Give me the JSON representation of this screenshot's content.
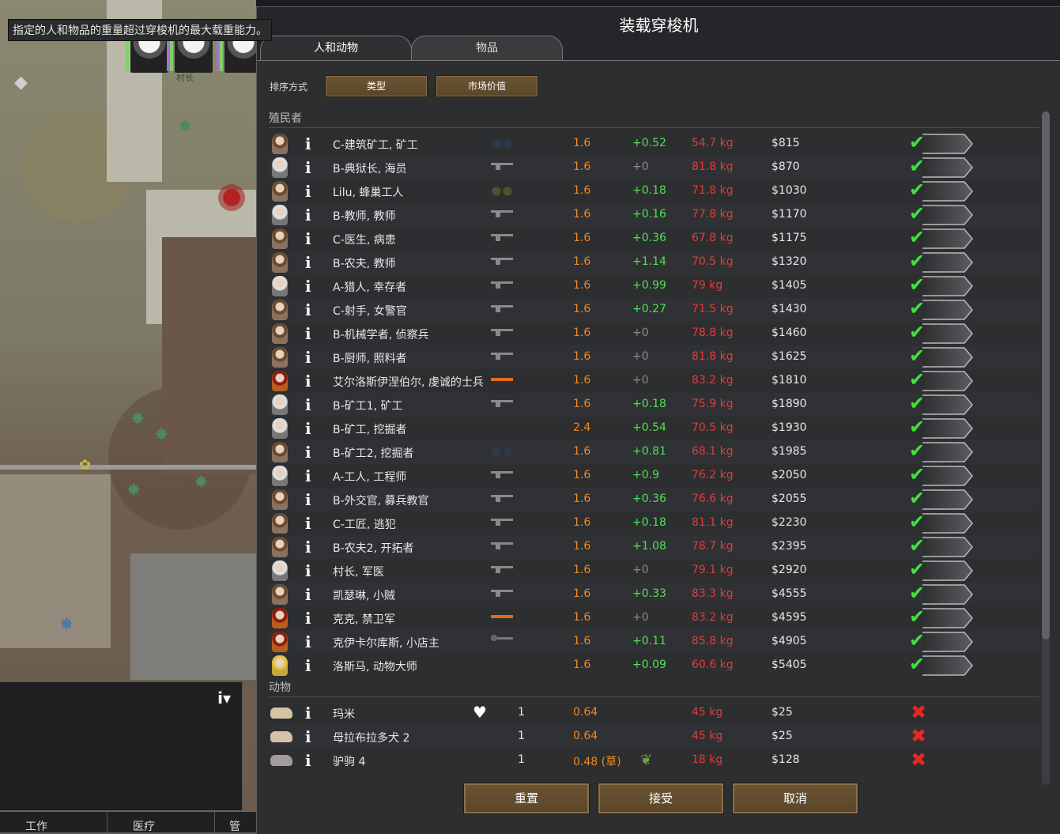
{
  "tooltip": "指定的人和物品的重量超过穿梭机的最大载重能力。",
  "dialog": {
    "title": "装载穿梭机",
    "tabs": [
      {
        "label": "人和动物",
        "active": true
      },
      {
        "label": "物品",
        "active": false
      }
    ],
    "sort": {
      "label": "排序方式",
      "options": [
        "类型",
        "市场价值"
      ]
    },
    "sections": {
      "colonists": "殖民者",
      "animals": "动物"
    },
    "colonists": [
      {
        "name": "C-建筑矿工, 矿工",
        "gear": "binoculars-blue-icon",
        "mass": "1.6",
        "speed": "+0.52",
        "weight": "54.7 kg",
        "value": "$815"
      },
      {
        "name": "B-典狱长, 海员",
        "gear": "rifle-icon",
        "mass": "1.6",
        "speed": "+0",
        "weight": "81.8 kg",
        "value": "$870"
      },
      {
        "name": "Lilu, 蜂巢工人",
        "gear": "binoculars-green-icon",
        "mass": "1.6",
        "speed": "+0.18",
        "weight": "71.8 kg",
        "value": "$1030"
      },
      {
        "name": "B-教师, 教师",
        "gear": "rifle-icon",
        "mass": "1.6",
        "speed": "+0.16",
        "weight": "77.8 kg",
        "value": "$1170"
      },
      {
        "name": "C-医生, 病患",
        "gear": "rifle-icon",
        "mass": "1.6",
        "speed": "+0.36",
        "weight": "67.8 kg",
        "value": "$1175"
      },
      {
        "name": "B-农夫, 教师",
        "gear": "rifle-icon",
        "mass": "1.6",
        "speed": "+1.14",
        "weight": "70.5 kg",
        "value": "$1320"
      },
      {
        "name": "A-猎人, 幸存者",
        "gear": "rifle-icon",
        "mass": "1.6",
        "speed": "+0.99",
        "weight": "79 kg",
        "value": "$1405"
      },
      {
        "name": "C-射手, 女警官",
        "gear": "rifle-icon",
        "mass": "1.6",
        "speed": "+0.27",
        "weight": "71.5 kg",
        "value": "$1430"
      },
      {
        "name": "B-机械学者, 侦察兵",
        "gear": "rifle-icon",
        "mass": "1.6",
        "speed": "+0",
        "weight": "78.8 kg",
        "value": "$1460"
      },
      {
        "name": "B-厨师, 照料者",
        "gear": "rifle-icon",
        "mass": "1.6",
        "speed": "+0",
        "weight": "81.8 kg",
        "value": "$1625"
      },
      {
        "name": "艾尔洛斯伊涅伯尔, 虔诚的士兵",
        "gear": "plasma-blade-icon",
        "mass": "1.6",
        "speed": "+0",
        "weight": "83.2 kg",
        "value": "$1810"
      },
      {
        "name": "B-矿工1, 矿工",
        "gear": "rifle-icon",
        "mass": "1.6",
        "speed": "+0.18",
        "weight": "75.9 kg",
        "value": "$1890"
      },
      {
        "name": "B-矿工, 挖掘者",
        "gear": "none",
        "mass": "2.4",
        "speed": "+0.54",
        "weight": "70.5 kg",
        "value": "$1930"
      },
      {
        "name": "B-矿工2, 挖掘者",
        "gear": "binoculars-blue-icon",
        "mass": "1.6",
        "speed": "+0.81",
        "weight": "68.1 kg",
        "value": "$1985"
      },
      {
        "name": "A-工人, 工程师",
        "gear": "rifle-icon",
        "mass": "1.6",
        "speed": "+0.9",
        "weight": "76.2 kg",
        "value": "$2050"
      },
      {
        "name": "B-外交官, 募兵教官",
        "gear": "rifle-icon",
        "mass": "1.6",
        "speed": "+0.36",
        "weight": "76.6 kg",
        "value": "$2055"
      },
      {
        "name": "C-工匠, 逃犯",
        "gear": "rifle-icon",
        "mass": "1.6",
        "speed": "+0.18",
        "weight": "81.1 kg",
        "value": "$2230"
      },
      {
        "name": "B-农夫2, 开拓者",
        "gear": "rifle-icon",
        "mass": "1.6",
        "speed": "+1.08",
        "weight": "78.7 kg",
        "value": "$2395"
      },
      {
        "name": "村长, 军医",
        "gear": "rifle-icon",
        "mass": "1.6",
        "speed": "+0",
        "weight": "79.1 kg",
        "value": "$2920"
      },
      {
        "name": "凯瑟琳, 小贼",
        "gear": "rifle-icon",
        "mass": "1.6",
        "speed": "+0.33",
        "weight": "83.3 kg",
        "value": "$4555"
      },
      {
        "name": "克克, 禁卫军",
        "gear": "plasma-blade-icon",
        "mass": "1.6",
        "speed": "+0",
        "weight": "83.2 kg",
        "value": "$4595"
      },
      {
        "name": "克伊卡尔库斯, 小店主",
        "gear": "pipe-gun-icon",
        "mass": "1.6",
        "speed": "+0.11",
        "weight": "85.8 kg",
        "value": "$4905"
      },
      {
        "name": "洛斯马, 动物大师",
        "gear": "none",
        "mass": "1.6",
        "speed": "+0.09",
        "weight": "60.6 kg",
        "value": "$5405"
      }
    ],
    "animals": [
      {
        "name": "玛米",
        "bonded": true,
        "count": "1",
        "mass": "0.64",
        "diet": "",
        "weight": "45 kg",
        "value": "$25"
      },
      {
        "name": "母拉布拉多犬 2",
        "bonded": false,
        "count": "1",
        "mass": "0.64",
        "diet": "",
        "weight": "45 kg",
        "value": "$25"
      },
      {
        "name": "驴驹 4",
        "bonded": false,
        "count": "1",
        "mass": "0.48 (草)",
        "diet": "grass-leaf-icon",
        "weight": "18 kg",
        "value": "$128"
      }
    ],
    "buttons": {
      "reset": "重置",
      "accept": "接受",
      "cancel": "取消"
    }
  },
  "bottom_bar": [
    "工作",
    "医疗",
    "管"
  ],
  "map_labels": {
    "pawn_caption": "村长"
  },
  "colors": {
    "check": "#3ee23e",
    "cross": "#e82626",
    "mass": "#ef8a22",
    "weight": "#e23c3c",
    "speed_positive": "#4fe24f"
  }
}
